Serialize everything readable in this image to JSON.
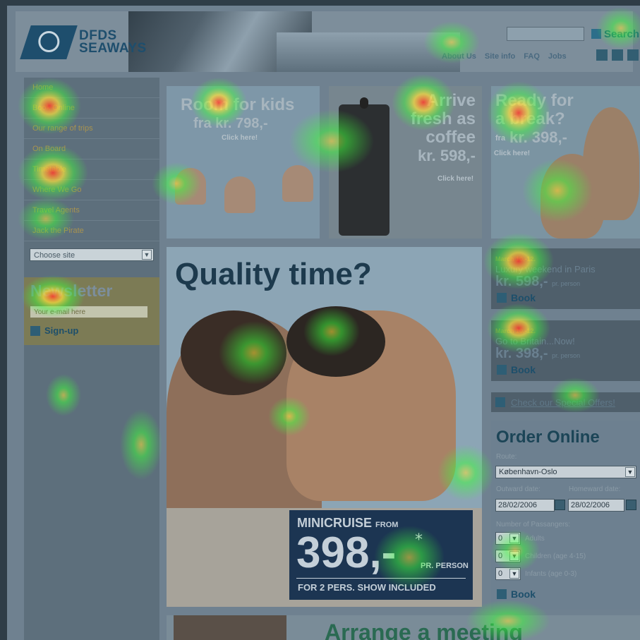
{
  "header": {
    "logo_line1": "DFDS",
    "logo_line2": "SEAWAYS",
    "search_label": "Search",
    "top_links": [
      "About Us",
      "Site info",
      "FAQ",
      "Jobs"
    ],
    "top_icons": [
      "home-icon",
      "mail-icon",
      "print-icon"
    ]
  },
  "sidebar": {
    "items": [
      {
        "label": "Home"
      },
      {
        "label": "Book Online"
      },
      {
        "label": "Our range of trips"
      },
      {
        "label": "On Board"
      },
      {
        "label": "Timetable"
      },
      {
        "label": "Where We Go"
      },
      {
        "label": "Travel Agents"
      },
      {
        "label": "Jack the Pirate"
      }
    ],
    "choose_site": "Choose site",
    "newsletter_title": "Newsletter",
    "email_placeholder": "Your e-mail here",
    "signup_label": "Sign-up"
  },
  "promos": [
    {
      "title": "Room for kids",
      "price": "fra kr. 798,-",
      "click": "Click here!"
    },
    {
      "title_1": "Arrive",
      "title_2": "fresh as",
      "title_3": "coffee",
      "price": "kr. 598,-",
      "click": "Click here!"
    },
    {
      "title_1": "Ready for",
      "title_2": "a break?",
      "price_prefix": "fra",
      "price": "kr. 398,-",
      "click": "Click here!"
    }
  ],
  "hero": {
    "headline": "Quality time?",
    "badge_line1": "MINICRUISE",
    "badge_from": "FROM",
    "badge_price": "398,-",
    "badge_star": "*",
    "badge_per": "PR. PERSON",
    "badge_footer": "FOR 2 PERS. SHOW INCLUDED"
  },
  "offers": [
    {
      "date": "March 10.-12.",
      "desc": "Luxury weekend in Paris",
      "price": "kr. 598,-",
      "per": "pr. person",
      "book": "Book"
    },
    {
      "date": "March 10.-12.",
      "desc": "Go to Britain...Now!",
      "price": "kr. 398,-",
      "per": "pr. person",
      "book": "Book"
    }
  ],
  "special_offers": "Check our Special Offers!",
  "order": {
    "title": "Order Online",
    "route_label": "Route:",
    "route_value": "København-Oslo",
    "outward_label": "Outward date:",
    "homeward_label": "Homeward date:",
    "outward_value": "28/02/2006",
    "homeward_value": "28/02/2006",
    "passengers_label": "Number of Passangers:",
    "passengers": [
      {
        "count": "0",
        "label": "Adults"
      },
      {
        "count": "0",
        "label": "Children (age 4-15)"
      },
      {
        "count": "0",
        "label": "Infants (age 0-3)"
      }
    ],
    "book": "Book"
  },
  "bottom": {
    "title": "Arrange a meeting"
  },
  "colors": {
    "brand": "#1e4e6d",
    "heat_hot": "#ff3b2e",
    "heat_warm": "#ffe23a",
    "heat_cool": "#3dff3a"
  }
}
